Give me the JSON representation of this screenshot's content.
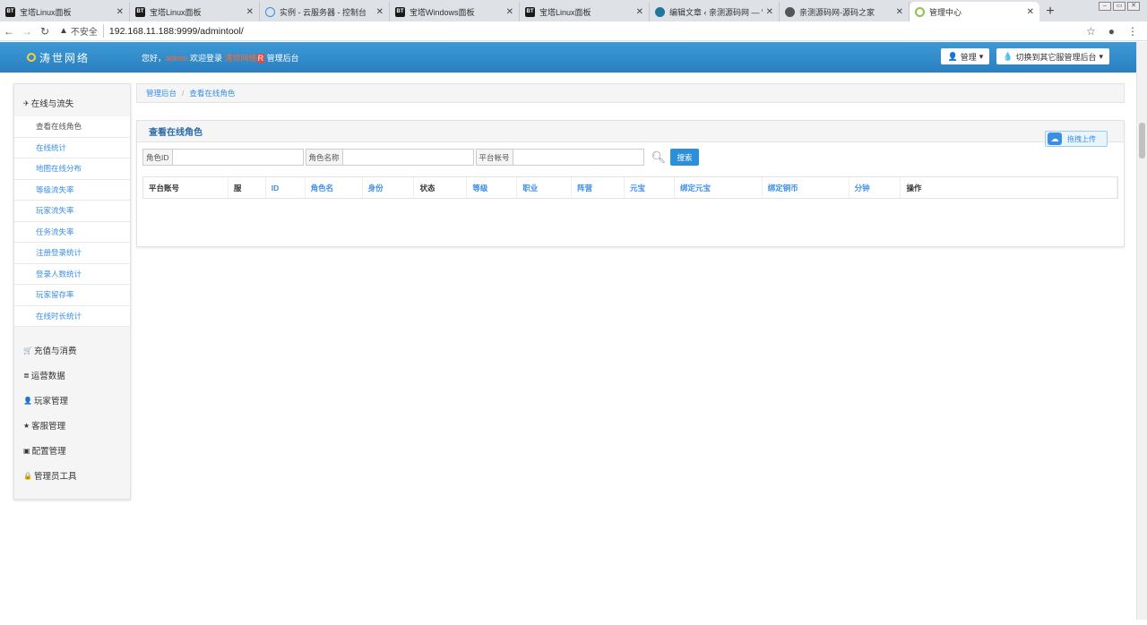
{
  "browser": {
    "tabs": [
      {
        "icon": "BT",
        "label": "宝塔Linux面板",
        "kind": "bt"
      },
      {
        "icon": "BT",
        "label": "宝塔Linux面板",
        "kind": "bt"
      },
      {
        "icon": "",
        "label": "实例 - 云服务器 - 控制台",
        "kind": "cloud"
      },
      {
        "icon": "BT",
        "label": "宝塔Windows面板",
        "kind": "bt"
      },
      {
        "icon": "BT",
        "label": "宝塔Linux面板",
        "kind": "bt"
      },
      {
        "icon": "",
        "label": "编辑文章 ‹ 亲测源码网 — W",
        "kind": "wp"
      },
      {
        "icon": "",
        "label": "亲测源码网-源码之家",
        "kind": "globe"
      },
      {
        "icon": "",
        "label": "管理中心",
        "kind": "leaf",
        "active": true
      }
    ],
    "not_secure": "不安全",
    "url": "192.168.11.188:9999/admintool/"
  },
  "header": {
    "logo_text": "涛世网络",
    "welcome_prefix": "您好，",
    "username": "admin",
    "welcome_mid": " 欢迎登录 ",
    "site_name": "涛世网络",
    "site_badge": "R",
    "welcome_suffix": " 管理后台",
    "manage_btn": "管理",
    "switch_btn": "切换到其它服管理后台"
  },
  "sidebar": {
    "sections": [
      {
        "label": "在线与流失",
        "icon": "✈",
        "items": [
          {
            "label": "查看在线角色",
            "active": true
          },
          {
            "label": "在线统计"
          },
          {
            "label": "地图在线分布"
          },
          {
            "label": "等级流失率"
          },
          {
            "label": "玩家流失率"
          },
          {
            "label": "任务流失率"
          },
          {
            "label": "注册登录统计"
          },
          {
            "label": "登录人数统计"
          },
          {
            "label": "玩家留存率"
          },
          {
            "label": "在线时长统计"
          }
        ]
      },
      {
        "label": "充值与消费",
        "icon": "🛒"
      },
      {
        "label": "运营数据",
        "icon": "≣"
      },
      {
        "label": "玩家管理",
        "icon": "👤"
      },
      {
        "label": "客服管理",
        "icon": "★"
      },
      {
        "label": "配置管理",
        "icon": "▣"
      },
      {
        "label": "管理员工具",
        "icon": "🔒"
      }
    ]
  },
  "breadcrumb": {
    "home": "管理后台",
    "current": "查看在线角色"
  },
  "panel": {
    "title": "查看在线角色",
    "upload_label": "拖拽上传"
  },
  "search": {
    "role_id_label": "角色ID",
    "role_id_value": "",
    "role_name_label": "角色名称",
    "role_name_value": "",
    "account_label": "平台帐号",
    "account_value": "",
    "button": "搜索"
  },
  "table": {
    "columns": [
      {
        "label": "平台账号",
        "link": false,
        "w": 95
      },
      {
        "label": "服",
        "link": false,
        "w": 42
      },
      {
        "label": "ID",
        "link": true,
        "w": 44
      },
      {
        "label": "角色名",
        "link": true,
        "w": 64
      },
      {
        "label": "身份",
        "link": true,
        "w": 58
      },
      {
        "label": "状态",
        "link": false,
        "w": 59
      },
      {
        "label": "等级",
        "link": true,
        "w": 56
      },
      {
        "label": "职业",
        "link": true,
        "w": 61
      },
      {
        "label": "阵营",
        "link": true,
        "w": 59
      },
      {
        "label": "元宝",
        "link": true,
        "w": 56
      },
      {
        "label": "绑定元宝",
        "link": true,
        "w": 98
      },
      {
        "label": "绑定铜币",
        "link": true,
        "w": 97
      },
      {
        "label": "分钟",
        "link": true,
        "w": 58
      },
      {
        "label": "操作",
        "link": false,
        "w": 242
      }
    ],
    "rows": []
  }
}
